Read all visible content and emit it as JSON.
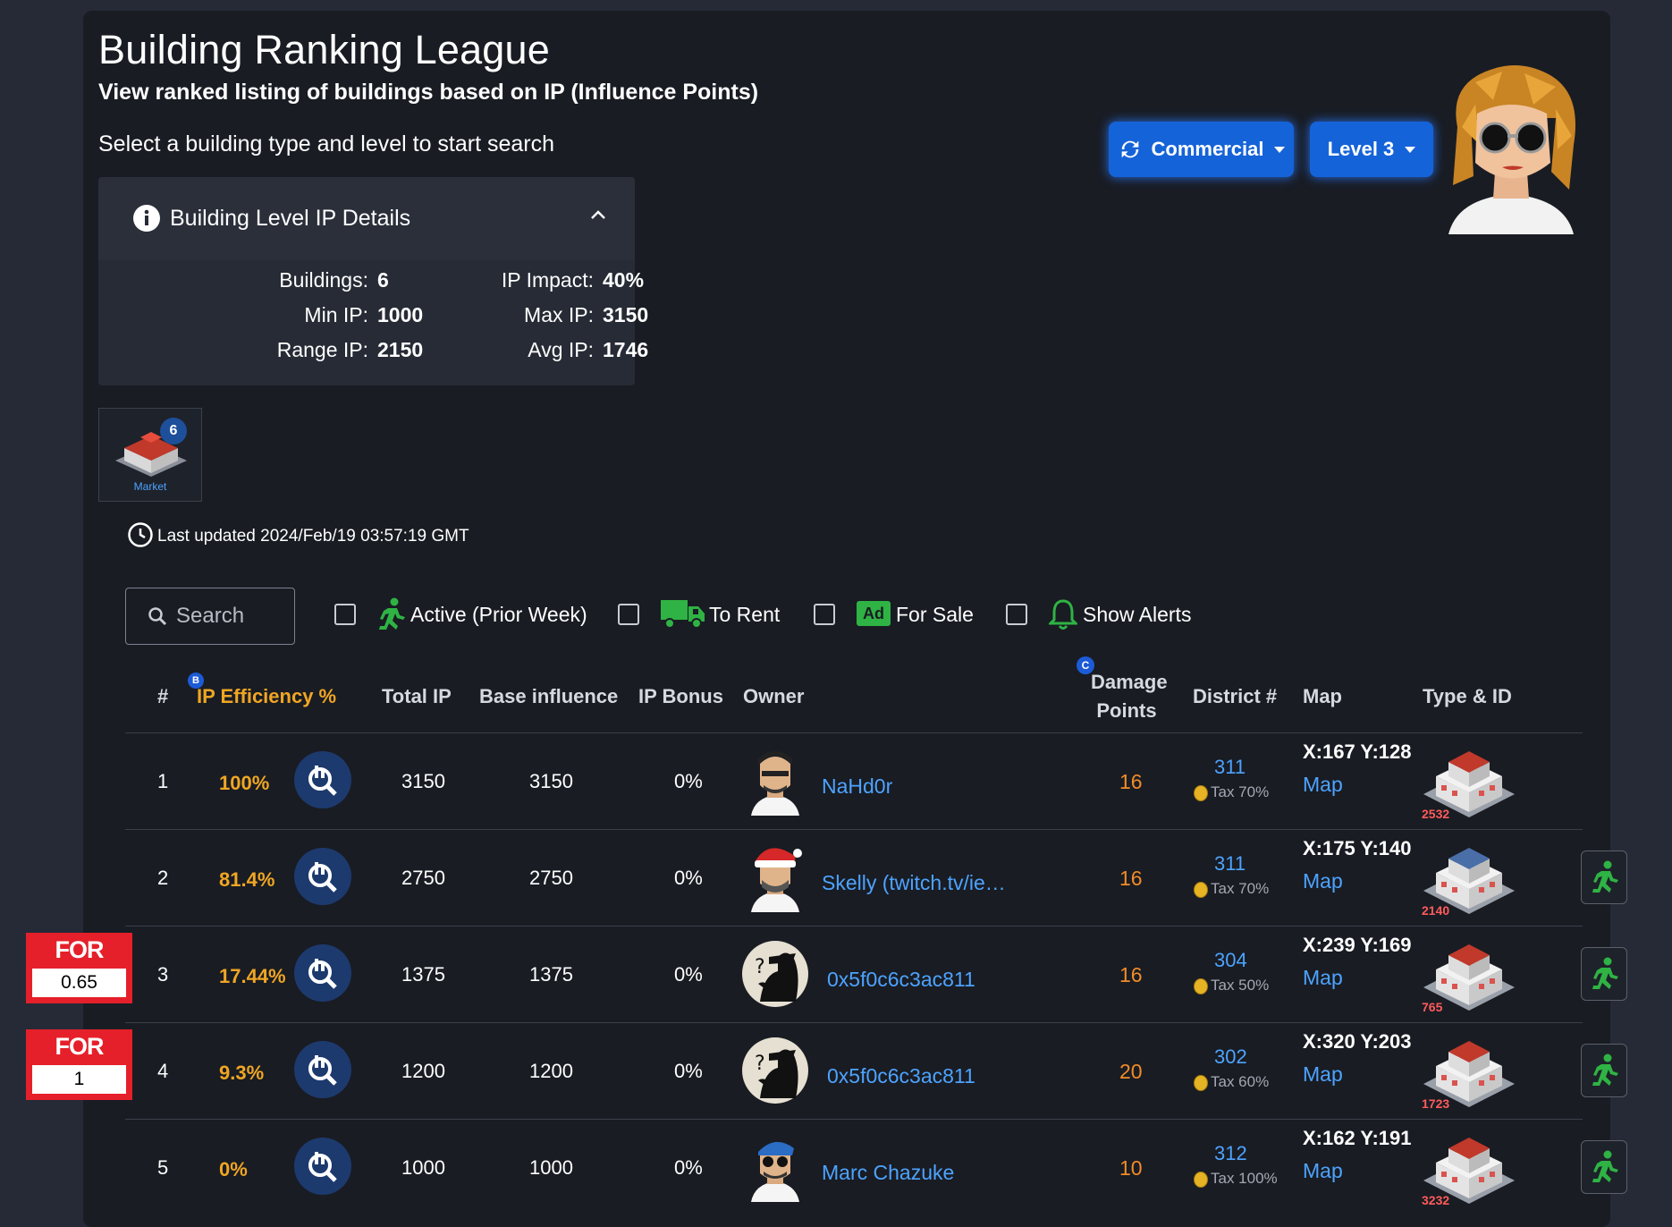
{
  "header": {
    "title": "Building Ranking League",
    "subtitle": "View ranked listing of buildings based on IP (Influence Points)",
    "prompt": "Select a building type and level to start search"
  },
  "controls": {
    "type_dropdown": "Commercial",
    "level_dropdown": "Level 3"
  },
  "details": {
    "heading": "Building Level IP Details",
    "labels": {
      "buildings": "Buildings:",
      "ip_impact": "IP Impact:",
      "min_ip": "Min IP:",
      "max_ip": "Max IP:",
      "range_ip": "Range IP:",
      "avg_ip": "Avg IP:"
    },
    "values": {
      "buildings": "6",
      "ip_impact": "40%",
      "min_ip": "1000",
      "max_ip": "3150",
      "range_ip": "2150",
      "avg_ip": "1746"
    }
  },
  "building_type_tile": {
    "label": "Market",
    "count": "6"
  },
  "last_updated": "Last updated 2024/Feb/19 03:57:19 GMT",
  "filters": {
    "search_placeholder": "Search",
    "active": "Active (Prior Week)",
    "to_rent": "To Rent",
    "for_sale": "For Sale",
    "ad_badge": "Ad",
    "show_alerts": "Show Alerts"
  },
  "table": {
    "headers": {
      "rank": "#",
      "efficiency": "IP Efficiency %",
      "efficiency_badge": "B",
      "total_ip": "Total IP",
      "base_influence": "Base influence",
      "ip_bonus": "IP Bonus",
      "owner": "Owner",
      "damage_line1": "Damage",
      "damage_line2": "Points",
      "damage_badge": "C",
      "district": "District #",
      "map": "Map",
      "type_id": "Type & ID"
    },
    "rows": [
      {
        "rank": "1",
        "efficiency": "100%",
        "total_ip": "3150",
        "base": "3150",
        "bonus": "0%",
        "owner": "NaHd0r",
        "damage": "16",
        "district": "311",
        "tax": "Tax 70%",
        "coords": "X:167 Y:128",
        "map": "Map",
        "building_id": "2532",
        "active": false,
        "for_sale": null
      },
      {
        "rank": "2",
        "efficiency": "81.4%",
        "total_ip": "2750",
        "base": "2750",
        "bonus": "0%",
        "owner": "Skelly (twitch.tv/ie…",
        "damage": "16",
        "district": "311",
        "tax": "Tax 70%",
        "coords": "X:175 Y:140",
        "map": "Map",
        "building_id": "2140",
        "active": true,
        "for_sale": null
      },
      {
        "rank": "3",
        "efficiency": "17.44%",
        "total_ip": "1375",
        "base": "1375",
        "bonus": "0%",
        "owner": "0x5f0c6c3ac811",
        "damage": "16",
        "district": "304",
        "tax": "Tax 50%",
        "coords": "X:239 Y:169",
        "map": "Map",
        "building_id": "765",
        "active": true,
        "for_sale": "0.65"
      },
      {
        "rank": "4",
        "efficiency": "9.3%",
        "total_ip": "1200",
        "base": "1200",
        "bonus": "0%",
        "owner": "0x5f0c6c3ac811",
        "damage": "20",
        "district": "302",
        "tax": "Tax 60%",
        "coords": "X:320 Y:203",
        "map": "Map",
        "building_id": "1723",
        "active": true,
        "for_sale": "1"
      },
      {
        "rank": "5",
        "efficiency": "0%",
        "total_ip": "1000",
        "base": "1000",
        "bonus": "0%",
        "owner": "Marc Chazuke",
        "damage": "10",
        "district": "312",
        "tax": "Tax 100%",
        "coords": "X:162 Y:191",
        "map": "Map",
        "building_id": "3232",
        "active": true,
        "for_sale": null
      }
    ]
  },
  "for_sale_label": "FOR SALE",
  "colors": {
    "background": "#252a36",
    "card": "#191c23",
    "accent_blue": "#1563d8",
    "efficiency": "#f0a623",
    "damage": "#f28c28",
    "link": "#4da3ff",
    "for_sale_red": "#e5202a",
    "active_green": "#2fb344"
  },
  "icons": [
    "refresh-icon",
    "info-icon",
    "chevron-up-icon",
    "clock-icon",
    "search-icon",
    "running-man-icon",
    "truck-icon",
    "ad-icon",
    "bell-icon",
    "query-search-icon",
    "coin-icon"
  ]
}
